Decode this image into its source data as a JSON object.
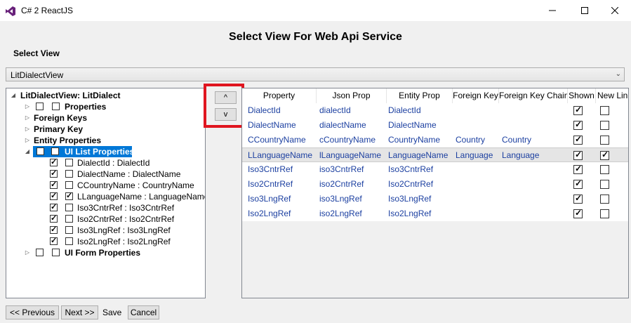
{
  "window": {
    "title": "C# 2 ReactJS",
    "accent": "#68217a"
  },
  "heading": "Select View For Web Api Service",
  "select_view_label": "Select View",
  "view_dropdown": {
    "value": "LitDialectView"
  },
  "tree": {
    "root": "LitDialectView: LitDialect",
    "properties": "Properties",
    "foreign_keys": "Foreign Keys",
    "primary_key": "Primary Key",
    "entity_properties": "Entity Properties",
    "ui_list_properties": "UI List Properties",
    "ui_list_items": [
      {
        "label": "DialectId : DialectId",
        "shown": true,
        "new_line": false
      },
      {
        "label": "DialectName : DialectName",
        "shown": true,
        "new_line": false
      },
      {
        "label": "CCountryName : CountryName",
        "shown": true,
        "new_line": false
      },
      {
        "label": "LLanguageName : LanguageName",
        "shown": true,
        "new_line": true
      },
      {
        "label": "Iso3CntrRef : Iso3CntrRef",
        "shown": true,
        "new_line": false
      },
      {
        "label": "Iso2CntrRef : Iso2CntrRef",
        "shown": true,
        "new_line": false
      },
      {
        "label": "Iso3LngRef : Iso3LngRef",
        "shown": true,
        "new_line": false
      },
      {
        "label": "Iso2LngRef : Iso2LngRef",
        "shown": true,
        "new_line": false
      }
    ],
    "ui_form_properties": "UI Form Properties"
  },
  "move_buttons": {
    "up": "^",
    "down": "v",
    "highlight_color": "#e0151f"
  },
  "grid": {
    "columns": [
      "Property",
      "Json Prop",
      "Entity Prop",
      "Foreign Key",
      "Foreign Key Chain",
      "Shown",
      "New Lin"
    ],
    "rows": [
      {
        "property": "DialectId",
        "json": "dialectId",
        "entity": "DialectId",
        "fk": "",
        "fk_chain": "",
        "shown": true,
        "new_line": false
      },
      {
        "property": "DialectName",
        "json": "dialectName",
        "entity": "DialectName",
        "fk": "",
        "fk_chain": "",
        "shown": true,
        "new_line": false
      },
      {
        "property": "CCountryName",
        "json": "cCountryName",
        "entity": "CountryName",
        "fk": "Country",
        "fk_chain": "Country",
        "shown": true,
        "new_line": false
      },
      {
        "property": "LLanguageName",
        "json": "lLanguageName",
        "entity": "LanguageName",
        "fk": "Language",
        "fk_chain": "Language",
        "shown": true,
        "new_line": true,
        "selected": true
      },
      {
        "property": "Iso3CntrRef",
        "json": "iso3CntrRef",
        "entity": "Iso3CntrRef",
        "fk": "",
        "fk_chain": "",
        "shown": true,
        "new_line": false
      },
      {
        "property": "Iso2CntrRef",
        "json": "iso2CntrRef",
        "entity": "Iso2CntrRef",
        "fk": "",
        "fk_chain": "",
        "shown": true,
        "new_line": false
      },
      {
        "property": "Iso3LngRef",
        "json": "iso3LngRef",
        "entity": "Iso3LngRef",
        "fk": "",
        "fk_chain": "",
        "shown": true,
        "new_line": false
      },
      {
        "property": "Iso2LngRef",
        "json": "iso2LngRef",
        "entity": "Iso2LngRef",
        "fk": "",
        "fk_chain": "",
        "shown": true,
        "new_line": false
      }
    ]
  },
  "footer": {
    "previous": "<< Previous",
    "next": "Next >>",
    "save": "Save",
    "cancel": "Cancel"
  }
}
